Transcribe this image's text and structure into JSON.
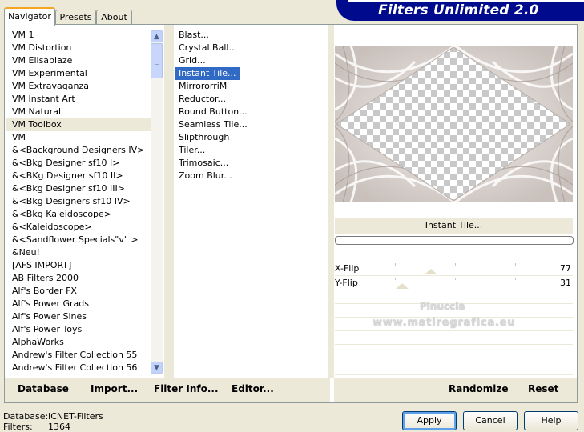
{
  "header": {
    "title": "Filters Unlimited 2.0"
  },
  "tabs": [
    {
      "label": "Navigator"
    },
    {
      "label": "Presets"
    },
    {
      "label": "About"
    }
  ],
  "categories": {
    "selected_index": 7,
    "items": [
      "VM 1",
      "VM Distortion",
      "VM Elisablaze",
      "VM Experimental",
      "VM Extravaganza",
      "VM Instant Art",
      "VM Natural",
      "VM Toolbox",
      "VM",
      "&<Background Designers IV>",
      "&<Bkg Designer sf10 I>",
      "&<BKg Designer sf10 II>",
      "&<Bkg Designer sf10 III>",
      "&<Bkg Designers sf10 IV>",
      "&<Bkg Kaleidoscope>",
      "&<Kaleidoscope>",
      "&<Sandflower Specials\"v\" >",
      "&Neu!",
      "[AFS IMPORT]",
      "AB Filters 2000",
      "Alf's Border FX",
      "Alf's Power Grads",
      "Alf's Power Sines",
      "Alf's Power Toys",
      "AlphaWorks",
      "Andrew's Filter Collection 55",
      "Andrew's Filter Collection 56"
    ]
  },
  "filters": {
    "selected_index": 3,
    "items": [
      "Blast...",
      "Crystal Ball...",
      "Grid...",
      "Instant Tile...",
      "MirrororriM",
      "Reductor...",
      "Round Button...",
      "Seamless Tile...",
      "Slipthrough",
      "Tiler...",
      "Trimosaic...",
      "Zoom Blur..."
    ]
  },
  "preview": {
    "filter_name": "Instant Tile...",
    "progress": 0
  },
  "params": [
    {
      "label": "X-Flip",
      "value": "77",
      "fraction": 0.302
    },
    {
      "label": "Y-Flip",
      "value": "31",
      "fraction": 0.122
    }
  ],
  "watermark": {
    "line1": "Pinuccia",
    "line2": "www.matiregrafica.eu"
  },
  "bottom_buttons": {
    "database": "Database",
    "import": "Import...",
    "filter_info": "Filter Info...",
    "editor": "Editor...",
    "randomize": "Randomize",
    "reset": "Reset"
  },
  "status": {
    "database_label": "Database:",
    "database_value": "ICNET-Filters",
    "filters_label": "Filters:",
    "filters_value": "1364"
  },
  "dialog_buttons": {
    "apply": "Apply",
    "cancel": "Cancel",
    "help": "Help"
  },
  "colors": {
    "selection": "#316ac5",
    "banner": "#000a8c",
    "face": "#ece9d8"
  }
}
